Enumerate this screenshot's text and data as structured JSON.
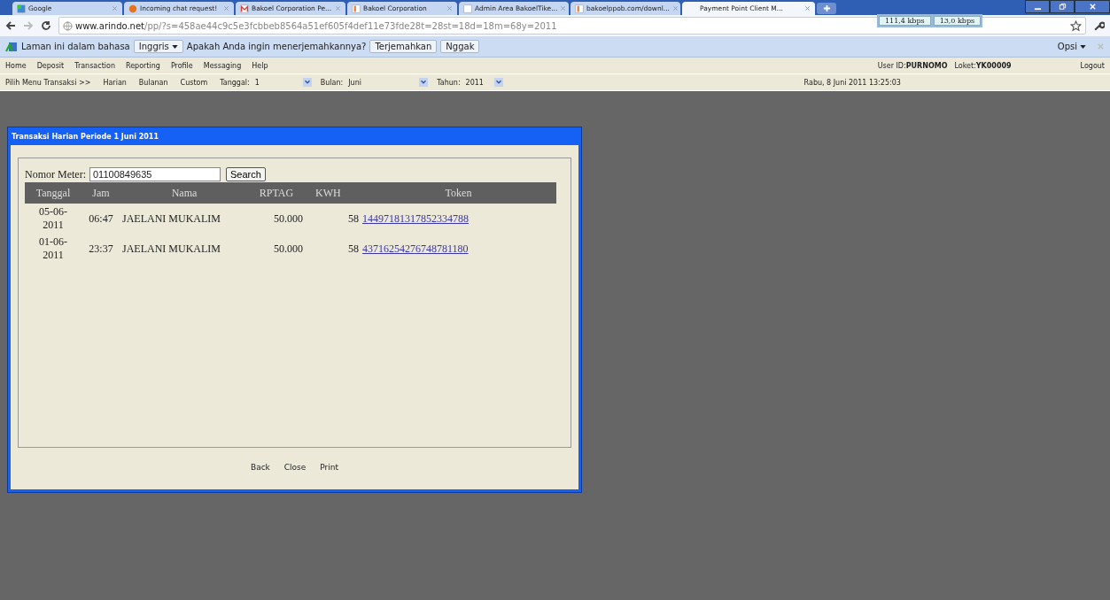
{
  "browser": {
    "tabs": [
      {
        "title": "Google",
        "selected": false
      },
      {
        "title": "Incoming chat request!",
        "selected": false
      },
      {
        "title": "Bakoel Corporation Pe...",
        "selected": false
      },
      {
        "title": "Bakoel Corporation",
        "selected": false
      },
      {
        "title": "Admin Area BakoelTike...",
        "selected": false
      },
      {
        "title": "bakoelppob.com/downl...",
        "selected": false
      },
      {
        "title": "Payment Point Client M...",
        "selected": true
      }
    ],
    "speed": [
      "111,4 kbps",
      "13,0 kbps"
    ],
    "url_host": "www.arindo.net",
    "url_rest": "/pp/?s=458ae44c9c5e3fcbbeb8564a51ef605f4def11e73fde28t=28st=18d=18m=68y=2011"
  },
  "translate_bar": {
    "text_before": "Laman ini dalam bahasa",
    "language": "Inggris",
    "question": "Apakah Anda ingin menerjemahkannya?",
    "buttons": [
      "Terjemahkan",
      "Nggak"
    ],
    "options": "Opsi"
  },
  "menu": {
    "items": [
      "Home",
      "Deposit",
      "Transaction",
      "Reporting",
      "Profile",
      "Messaging",
      "Help"
    ],
    "user": "User ID:**PURNOMO**",
    "loket": "Loket:**YK00009**",
    "logout": "Logout"
  },
  "submenu": {
    "label": "Pilih Menu Transaksi >>",
    "links": [
      "Harian",
      "Bulanan",
      "Custom"
    ],
    "filters": [
      {
        "label": "Tanggal:",
        "value": "1"
      },
      {
        "label": "Bulan:",
        "value": "Juni"
      },
      {
        "label": "Tahun:",
        "value": "2011"
      }
    ],
    "datetime": "Rabu, 8 Juni 2011 13:25:03"
  },
  "dialog": {
    "title": "Transaksi Harian Periode 1 Juni 2011",
    "meter_label": "Nomor Meter:",
    "meter_value": "01100849635",
    "search": "Search",
    "table": {
      "columns": [
        "Tanggal",
        "Jam",
        "Nama",
        "RPTAG",
        "KWH",
        "Token"
      ],
      "rows": [
        [
          "05-06-2011",
          "06:47",
          "JAELANI MUKALIM",
          "50.000",
          "58",
          "14497181317852334788"
        ],
        [
          "01-06-2011",
          "23:37",
          "JAELANI MUKALIM",
          "50.000",
          "58",
          "43716254276748781180"
        ]
      ]
    },
    "footer": [
      "Back",
      "Close",
      "Print"
    ]
  }
}
